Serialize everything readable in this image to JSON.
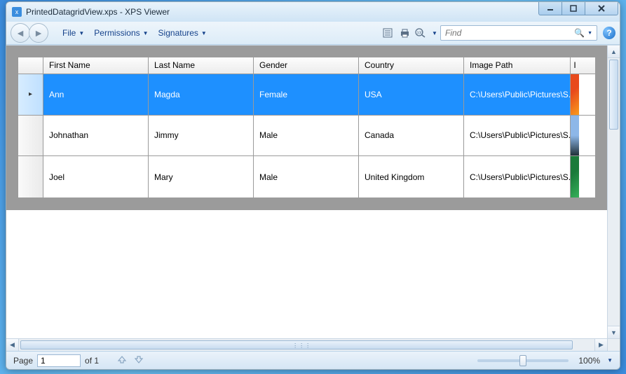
{
  "window": {
    "title": "PrintedDatagridView.xps - XPS Viewer"
  },
  "menu": {
    "file": "File",
    "permissions": "Permissions",
    "signatures": "Signatures"
  },
  "search": {
    "placeholder": "Find"
  },
  "grid": {
    "headers": {
      "first_name": "First Name",
      "last_name": "Last Name",
      "gender": "Gender",
      "country": "Country",
      "image_path": "Image Path",
      "image_partial": "I"
    },
    "rows": [
      {
        "first_name": "Ann",
        "last_name": "Magda",
        "gender": "Female",
        "country": "USA",
        "image_path": "C:\\Users\\Public\\Pictures\\S...",
        "selected": true
      },
      {
        "first_name": "Johnathan",
        "last_name": "Jimmy",
        "gender": "Male",
        "country": "Canada",
        "image_path": "C:\\Users\\Public\\Pictures\\S...",
        "selected": false
      },
      {
        "first_name": "Joel",
        "last_name": "Mary",
        "gender": "Male",
        "country": "United Kingdom",
        "image_path": "C:\\Users\\Public\\Pictures\\S...",
        "selected": false
      }
    ]
  },
  "status": {
    "page_label": "Page",
    "page_current": "1",
    "page_of": "of 1",
    "zoom": "100%"
  }
}
